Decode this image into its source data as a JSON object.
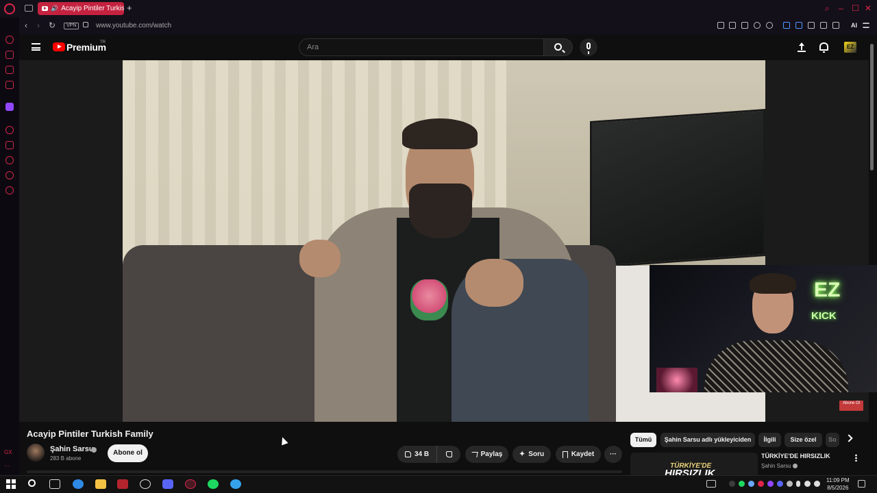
{
  "browser": {
    "tab_title": "Acayip Pintiler Turkish F",
    "url": "www.youtube.com/watch",
    "vpn_label": "VPN",
    "ai_label": "AI",
    "new_tab": "+",
    "sidebar_label": "GX",
    "sidebar_more": "···",
    "accent": "#e0254a"
  },
  "youtube": {
    "brand": "Premium",
    "region": "TR",
    "search_placeholder": "Ara",
    "avatar_label": "EZ"
  },
  "video": {
    "title": "Acayip Pintiler Turkish Family",
    "facecam_sign_top": "EZ",
    "facecam_sign_bottom": "KICK",
    "corner_badge": "Abone Ol",
    "thumbnail_brand_colors": {
      "red": "#ff0000"
    }
  },
  "channel": {
    "name": "Şahin Sarsu",
    "subscribers": "283 B abone",
    "subscribe_label": "Abone ol"
  },
  "actions": {
    "likes": "34 B",
    "share": "Paylaş",
    "ask": "Soru",
    "save": "Kaydet",
    "more": "···"
  },
  "chips": [
    "Tümü",
    "Şahin Sarsu adlı yükleyiciden",
    "İlgili",
    "Size özel",
    "So"
  ],
  "recommendation": {
    "title": "TÜRKİYE'DE HIRSIZLIK",
    "channel": "Şahin Sarsu",
    "thumb_small": "TÜRKİYE'DE",
    "thumb_big": "HIRSIZLIK"
  },
  "taskbar": {
    "time": "11:09 PM",
    "date": "8/5/2026"
  }
}
